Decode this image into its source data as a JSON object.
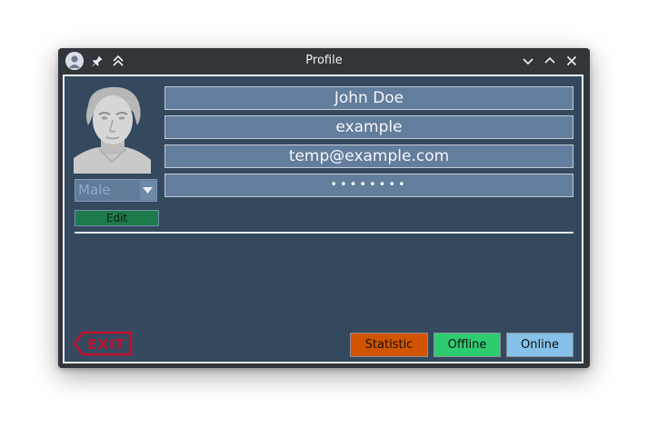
{
  "window": {
    "title": "Profile"
  },
  "titlebar": {
    "icons": [
      "avatar-icon",
      "pin-icon",
      "keep-above-icon",
      "minimize-icon",
      "maximize-icon",
      "close-icon"
    ]
  },
  "profile": {
    "name": "John Doe",
    "username": "example",
    "email": "temp@example.com",
    "password_mask": "••••••••",
    "gender": "Male",
    "edit_label": "Edit"
  },
  "footer": {
    "exit_label": "EXIT",
    "statistic_label": "Statistic",
    "offline_label": "Offline",
    "online_label": "Online"
  },
  "colors": {
    "content_bg": "#34495e",
    "field_bg": "#637d9c",
    "statistic": "#d35400",
    "offline": "#2ecc71",
    "online": "#85c1e9",
    "edit": "#1e7a4a",
    "exit": "#c0112f"
  }
}
